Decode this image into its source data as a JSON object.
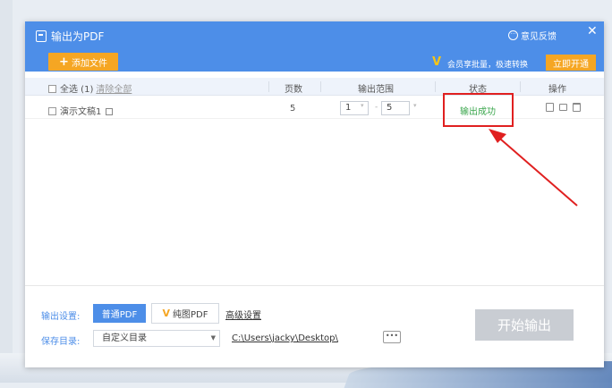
{
  "window": {
    "title": "输出为PDF",
    "feedback_label": "意见反馈",
    "close_glyph": "✕"
  },
  "toolbar": {
    "add_label": "添加文件",
    "add_glyph": "+",
    "vip_promo": "会员享批量，极速转换",
    "open_label": "立即开通"
  },
  "table": {
    "select_all": "全选 (1)",
    "clear_all": "清除全部",
    "headers": {
      "pages": "页数",
      "range": "输出范围",
      "status": "状态",
      "actions": "操作"
    },
    "rows": [
      {
        "name": "演示文稿1",
        "pages": "5",
        "range_from": "1",
        "range_to": "5",
        "range_sep": "-",
        "status": "输出成功"
      }
    ]
  },
  "settings": {
    "output_label": "输出设置:",
    "normal_pdf": "普通PDF",
    "pure_pdf": "纯图PDF",
    "advanced": "高级设置",
    "save_label": "保存目录:",
    "dir_option": "自定义目录",
    "path": "C:\\Users\\jacky\\Desktop\\",
    "more_glyph": "•••",
    "start_label": "开始输出"
  },
  "colors": {
    "header_blue": "#4d8ee8",
    "accent_orange": "#f5a623",
    "success_green": "#3aa64c",
    "highlight_red": "#e02020",
    "disabled_gray": "#c9cdd3"
  }
}
